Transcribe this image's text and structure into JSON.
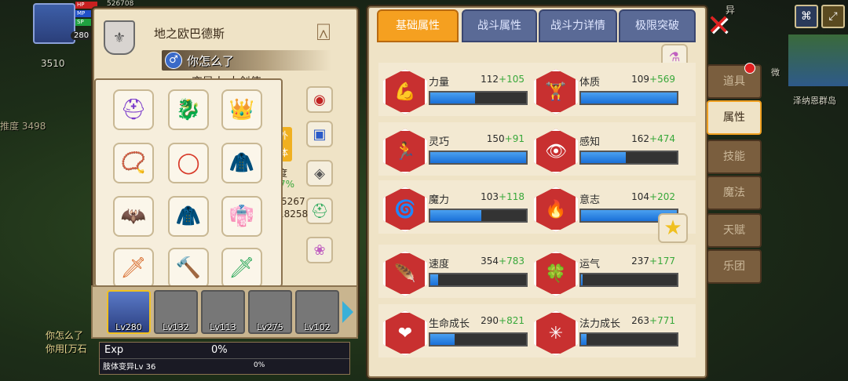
{
  "hud": {
    "stats": "526708",
    "level": "280",
    "bars": [
      "HP",
      "MP",
      "SP"
    ],
    "gold": "3510",
    "power_label": "推度 3498"
  },
  "chat": {
    "lines": [
      "你怎么了",
      "你用[万石"
    ]
  },
  "world": {
    "island_name": "泽纳恩群岛",
    "side_bits": [
      "异",
      "微"
    ]
  },
  "character": {
    "name": "地之欧巴德斯",
    "mood": "你怎么了",
    "occupation": "变异人 大剑使",
    "extra_badge": "外体",
    "stat_frags": [
      "度",
      "7%",
      "/5267",
      "18258"
    ],
    "gender_icon": "male-icon"
  },
  "equipment": {
    "slots": [
      {
        "name": "dark-helmet-icon",
        "glyph": "⛑",
        "color": "#7a3acb"
      },
      {
        "name": "dragon-head-icon",
        "glyph": "🐉",
        "color": "#d83a2a"
      },
      {
        "name": "gold-crown-icon",
        "glyph": "👑",
        "color": "#e8b020"
      },
      {
        "name": "gem-necklace-icon",
        "glyph": "📿",
        "color": "#d86a2a"
      },
      {
        "name": "red-ring-necklace-icon",
        "glyph": "◯",
        "color": "#d83a2a"
      },
      {
        "name": "red-armor-icon",
        "glyph": "🧥",
        "color": "#b82020"
      },
      {
        "name": "bat-wings-icon",
        "glyph": "🦇",
        "color": "#7a3acb"
      },
      {
        "name": "blue-coat-icon",
        "glyph": "🧥",
        "color": "#2a5ac8"
      },
      {
        "name": "crimson-robe-icon",
        "glyph": "👘",
        "color": "#8a1a3a"
      },
      {
        "name": "flame-spear-icon",
        "glyph": "🗡",
        "color": "#d86a2a"
      },
      {
        "name": "silver-hammer-icon",
        "glyph": "🔨",
        "color": "#888"
      },
      {
        "name": "jade-sword-icon",
        "glyph": "🗡",
        "color": "#2aa85a"
      }
    ],
    "side_items": [
      "red-emblem-icon",
      "blue-chest-icon",
      "dark-armor-icon",
      "green-helmet-icon",
      "bunny-icon"
    ]
  },
  "party": {
    "members": [
      {
        "level": "Lv280",
        "selected": true
      },
      {
        "level": "Lv132",
        "selected": false
      },
      {
        "level": "Lv113",
        "selected": false
      },
      {
        "level": "Lv275",
        "selected": false
      },
      {
        "level": "Lv102",
        "selected": false
      }
    ]
  },
  "exp": {
    "label": "Exp",
    "value": "0%",
    "sub_label": "肢体变异Lv 36",
    "sub_value": "0%"
  },
  "tabs": [
    "基础属性",
    "战斗属性",
    "战斗力详情",
    "极限突破"
  ],
  "stats": [
    [
      {
        "name": "力量",
        "base": "112",
        "bonus": "+105",
        "pct": 0.47,
        "icon": "muscle-arm-icon",
        "glyph": "💪"
      },
      {
        "name": "体质",
        "base": "109",
        "bonus": "+569",
        "pct": 1.0,
        "icon": "strongman-icon",
        "glyph": "🏋"
      }
    ],
    [
      {
        "name": "灵巧",
        "base": "150",
        "bonus": "+91",
        "pct": 1.0,
        "icon": "running-man-icon",
        "glyph": "🏃"
      },
      {
        "name": "感知",
        "base": "162",
        "bonus": "+474",
        "pct": 0.47,
        "icon": "eye-icon",
        "glyph": "👁"
      }
    ],
    [
      {
        "name": "魔力",
        "base": "103",
        "bonus": "+118",
        "pct": 0.53,
        "icon": "swirl-icon",
        "glyph": "🌀"
      },
      {
        "name": "意志",
        "base": "104",
        "bonus": "+202",
        "pct": 1.0,
        "icon": "will-flame-icon",
        "glyph": "🔥"
      }
    ],
    [
      {
        "name": "速度",
        "base": "354",
        "bonus": "+783",
        "pct": 0.08,
        "icon": "speed-wing-icon",
        "glyph": "🪶"
      },
      {
        "name": "运气",
        "base": "237",
        "bonus": "+177",
        "pct": 0.02,
        "icon": "clover-icon",
        "glyph": "🍀"
      }
    ],
    [
      {
        "name": "生命成长",
        "base": "290",
        "bonus": "+821",
        "pct": 0.25,
        "icon": "heart-growth-icon",
        "glyph": "❤"
      },
      {
        "name": "法力成长",
        "base": "263",
        "bonus": "+771",
        "pct": 0.06,
        "icon": "mana-growth-icon",
        "glyph": "✳"
      }
    ]
  ],
  "side_menu": [
    {
      "label": "道具",
      "active": false,
      "dot": true
    },
    {
      "label": "属性",
      "active": true,
      "dot": false
    },
    {
      "label": "技能",
      "active": false,
      "dot": false
    },
    {
      "label": "魔法",
      "active": false,
      "dot": false
    },
    {
      "label": "天赋",
      "active": false,
      "dot": false
    },
    {
      "label": "乐团",
      "active": false,
      "dot": false
    }
  ],
  "colors": {
    "accent": "#f5a020",
    "bar_fill": "#1a70d8",
    "bonus_green": "#38a83a",
    "stat_hex": "#c83030"
  }
}
